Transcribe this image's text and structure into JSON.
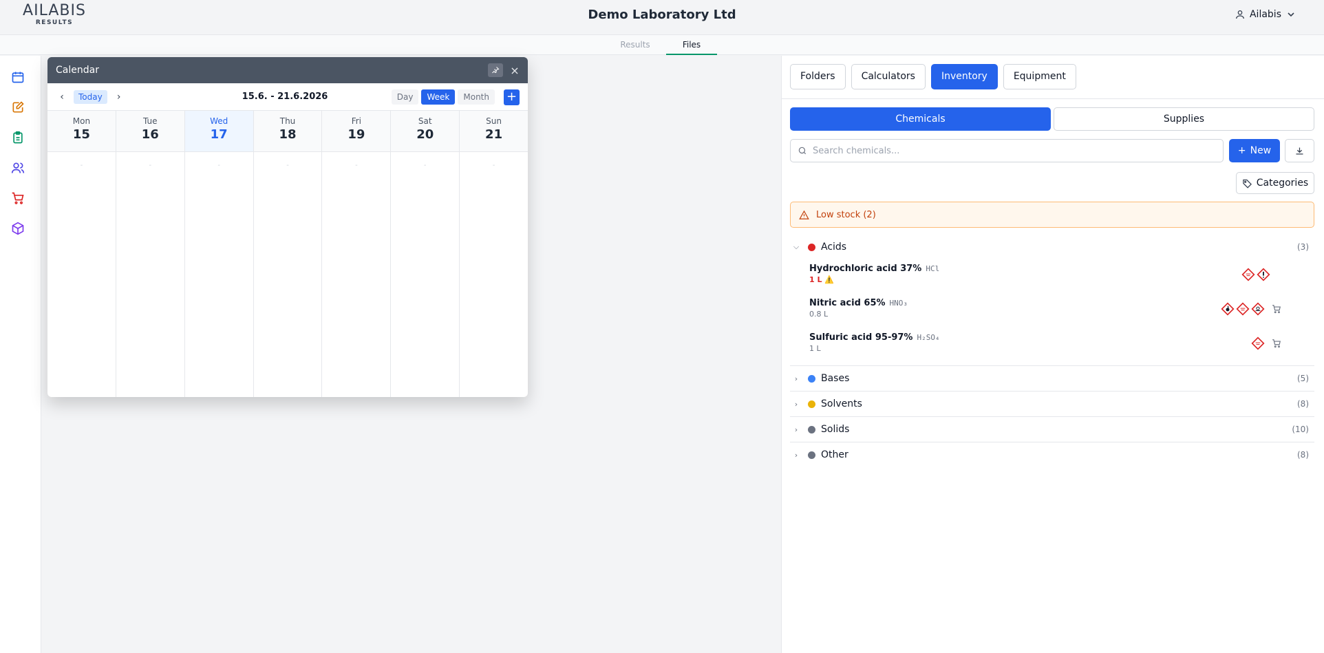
{
  "header": {
    "logo_main": "AILABIS",
    "logo_sub": "RESULTS",
    "org_title": "Demo Laboratory Ltd",
    "user_name": "Ailabis"
  },
  "top_tabs": [
    {
      "label": "Results",
      "active": false
    },
    {
      "label": "Files",
      "active": true
    }
  ],
  "rail_icons": [
    "calendar-icon",
    "notebook-edit-icon",
    "clipboard-icon",
    "users-icon",
    "cart-icon",
    "package-icon"
  ],
  "background_hint": "t",
  "calendar": {
    "title": "Calendar",
    "today_label": "Today",
    "range": "15.6. - 21.6.2026",
    "views": [
      "Day",
      "Week",
      "Month"
    ],
    "active_view": "Week",
    "add_label": "+",
    "days": [
      {
        "name": "Mon",
        "date": "15"
      },
      {
        "name": "Tue",
        "date": "16"
      },
      {
        "name": "Wed",
        "date": "17",
        "today": true
      },
      {
        "name": "Thu",
        "date": "18"
      },
      {
        "name": "Fri",
        "date": "19"
      },
      {
        "name": "Sat",
        "date": "20"
      },
      {
        "name": "Sun",
        "date": "21"
      }
    ],
    "empty_marker": "-"
  },
  "right_panel": {
    "tabs": [
      "Folders",
      "Calculators",
      "Inventory",
      "Equipment"
    ],
    "active_tab": "Inventory",
    "segments": [
      "Chemicals",
      "Supplies"
    ],
    "active_segment": "Chemicals",
    "search_placeholder": "Search chemicals...",
    "new_label": "New",
    "categories_label": "Categories",
    "low_stock_label": "Low stock (2)",
    "groups": [
      {
        "name": "Acids",
        "count": "(3)",
        "color": "#dc2626",
        "expanded": true
      },
      {
        "name": "Bases",
        "count": "(5)",
        "color": "#3b82f6",
        "expanded": false
      },
      {
        "name": "Solvents",
        "count": "(8)",
        "color": "#eab308",
        "expanded": false
      },
      {
        "name": "Solids",
        "count": "(10)",
        "color": "#6b7280",
        "expanded": false
      },
      {
        "name": "Other",
        "count": "(8)",
        "color": "#6b7280",
        "expanded": false
      }
    ],
    "items": [
      {
        "name": "Hydrochloric acid 37%",
        "formula": "HCl",
        "qty": "1 L",
        "low": true,
        "hazards": [
          "corrosive",
          "exclamation"
        ],
        "cart": false
      },
      {
        "name": "Nitric acid 65%",
        "formula": "HNO₃",
        "qty": "0.8 L",
        "low": false,
        "hazards": [
          "oxidizer",
          "corrosive",
          "toxic"
        ],
        "cart": true
      },
      {
        "name": "Sulfuric acid 95-97%",
        "formula": "H₂SO₄",
        "qty": "1 L",
        "low": false,
        "hazards": [
          "corrosive"
        ],
        "cart": true
      }
    ]
  },
  "colors": {
    "accent": "#2563eb",
    "files_underline": "#059669",
    "warning": "#c2410c",
    "hazard": "#dc2626"
  }
}
